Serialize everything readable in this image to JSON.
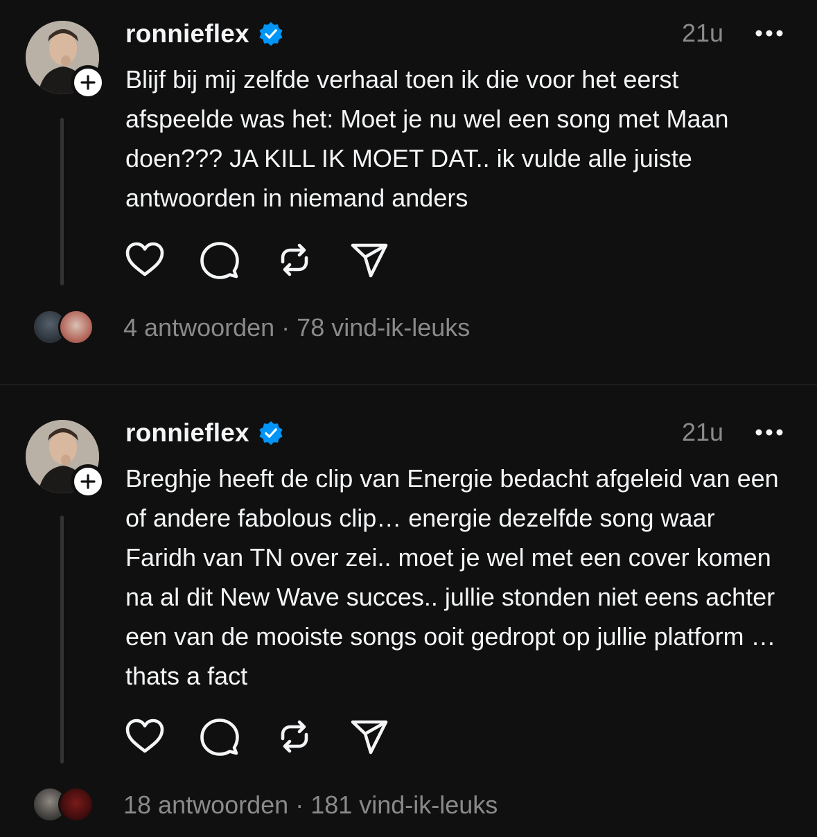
{
  "posts": [
    {
      "username": "ronnieflex",
      "time": "21u",
      "text": "Blijf bij mij zelfde verhaal toen ik die voor het eerst afspeelde was het: Moet je nu wel een song met Maan doen??? JA KILL IK MOET DAT.. ik vulde alle juiste antwoorden in niemand anders",
      "replies": "4 antwoorden",
      "separator": "·",
      "likes": "78 vind-ik-leuks"
    },
    {
      "username": "ronnieflex",
      "time": "21u",
      "text": "Breghje heeft de clip van Energie bedacht afgeleid van een of andere fabolous clip… energie dezelfde song waar Faridh van TN over zei.. moet je wel met een cover komen na al dit New Wave succes.. jullie stonden niet eens achter een van de mooiste songs ooit gedropt op jullie platform … thats a fact",
      "replies": "18 antwoorden",
      "separator": "·",
      "likes": "181 vind-ik-leuks"
    }
  ],
  "icons": {
    "verified": "verified-badge-icon",
    "more": "more-options-icon",
    "follow": "plus-icon",
    "like": "heart-icon",
    "reply": "comment-bubble-icon",
    "repost": "repost-arrows-icon",
    "share": "send-paper-plane-icon"
  },
  "colors": {
    "background": "#101010",
    "text": "#f3f5f7",
    "secondary": "#8a8a8a",
    "verified": "#0095f6"
  }
}
